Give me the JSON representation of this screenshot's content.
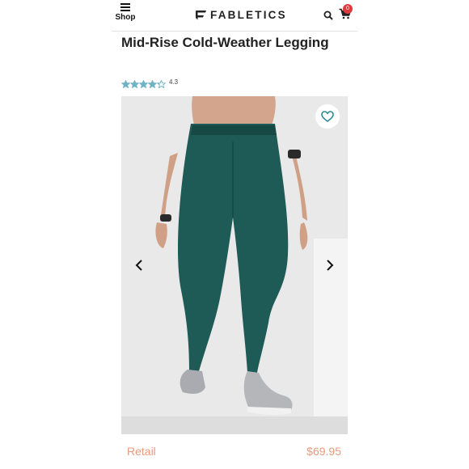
{
  "header": {
    "menu_label": "Shop",
    "brand": "FABLETICS",
    "cart_count": "0"
  },
  "product": {
    "title": "Mid-Rise Cold-Weather Legging",
    "rating": "4.3",
    "rating_value": 4.3,
    "rating_max": 5,
    "price_label": "Retail",
    "price": "$69.95"
  },
  "colors": {
    "star": "#6fb3c4",
    "accent_teal": "#2a8a93",
    "price": "#e79b7d",
    "badge": "#e03a3e",
    "legging": "#1e5a56"
  },
  "icons": {
    "menu": "hamburger-icon",
    "search": "search-icon",
    "cart": "cart-icon",
    "favorite": "heart-icon",
    "prev": "chevron-left-icon",
    "next": "chevron-right-icon"
  }
}
